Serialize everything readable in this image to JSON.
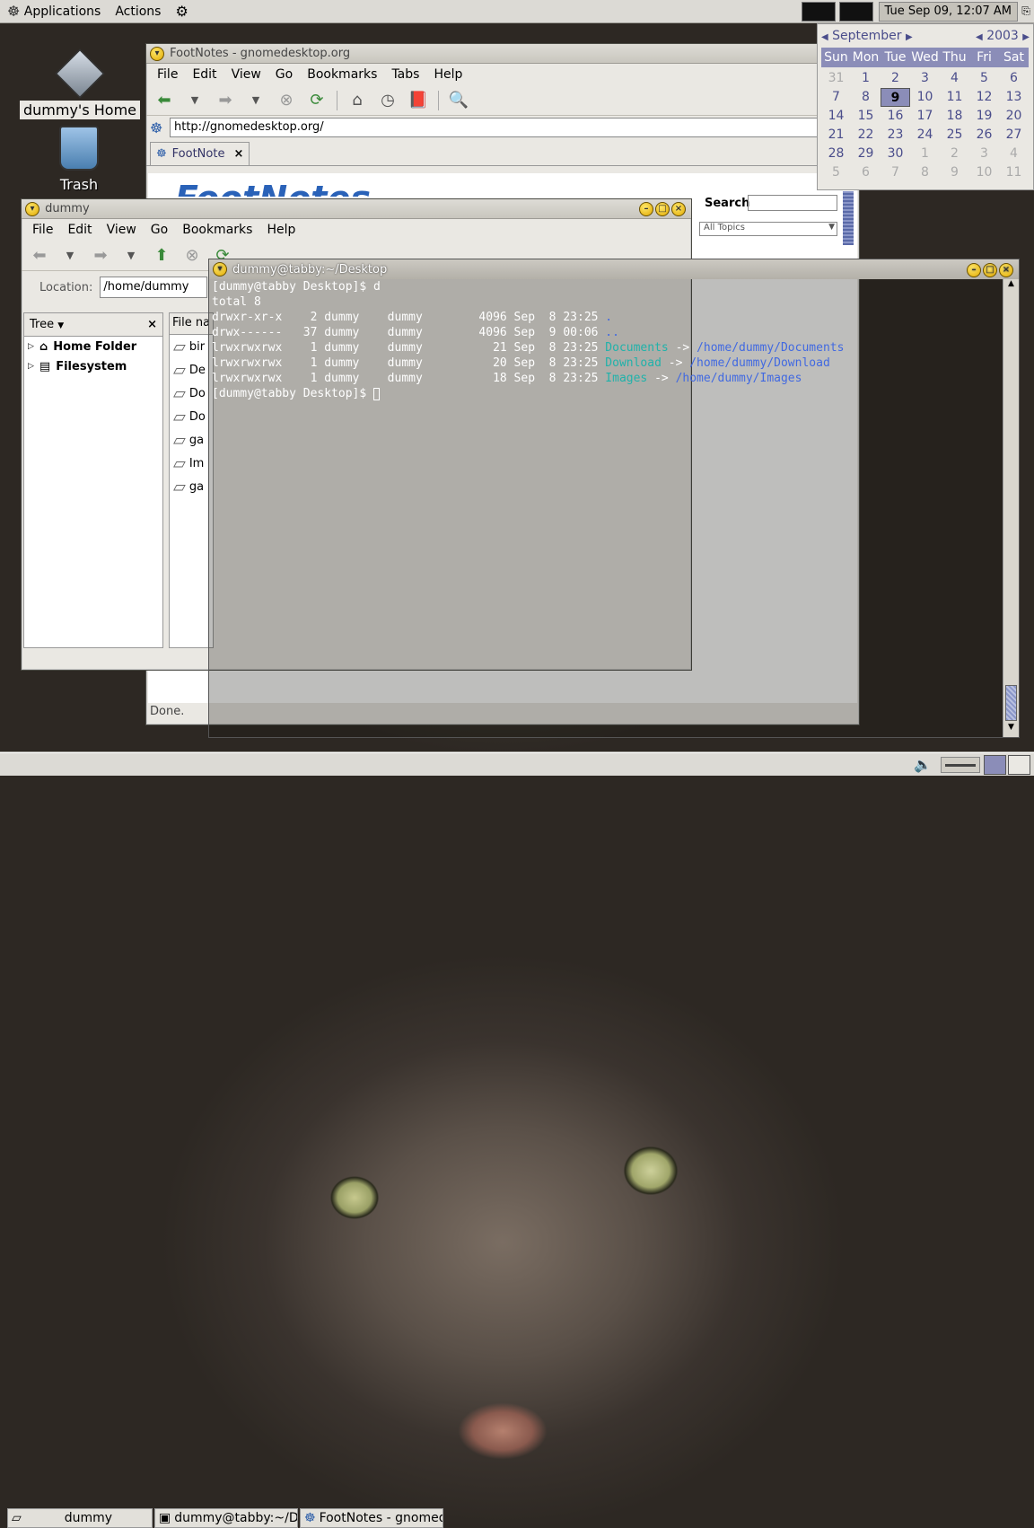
{
  "top_panel": {
    "applications": "Applications",
    "actions": "Actions",
    "clock": "Tue Sep 09, 12:07 AM"
  },
  "calendar": {
    "month": "September",
    "year": "2003",
    "weekdays": [
      "Sun",
      "Mon",
      "Tue",
      "Wed",
      "Thu",
      "Fri",
      "Sat"
    ],
    "days": [
      [
        "31",
        "1",
        "2",
        "3",
        "4",
        "5",
        "6"
      ],
      [
        "7",
        "8",
        "9",
        "10",
        "11",
        "12",
        "13"
      ],
      [
        "14",
        "15",
        "16",
        "17",
        "18",
        "19",
        "20"
      ],
      [
        "21",
        "22",
        "23",
        "24",
        "25",
        "26",
        "27"
      ],
      [
        "28",
        "29",
        "30",
        "1",
        "2",
        "3",
        "4"
      ],
      [
        "5",
        "6",
        "7",
        "8",
        "9",
        "10",
        "11"
      ]
    ],
    "today": "9"
  },
  "desktop": {
    "home": "dummy's Home",
    "trash": "Trash"
  },
  "browser": {
    "title": "FootNotes - gnomedesktop.org",
    "menu": [
      "File",
      "Edit",
      "View",
      "Go",
      "Bookmarks",
      "Tabs",
      "Help"
    ],
    "url": "http://gnomedesktop.org/",
    "tab": "FootNote",
    "search_label": "Search",
    "topics": "All Topics",
    "status": "Done.",
    "brand": "FootNotes"
  },
  "files": {
    "title": "dummy",
    "menu": [
      "File",
      "Edit",
      "View",
      "Go",
      "Bookmarks",
      "Help"
    ],
    "location_label": "Location:",
    "location": "/home/dummy",
    "tree_label": "Tree",
    "tree": [
      "Home Folder",
      "Filesystem"
    ],
    "file_col": "File na",
    "files": [
      "bir",
      "De",
      "Do",
      "Do",
      "ga",
      "Im",
      "ga"
    ]
  },
  "terminal": {
    "title": "dummy@tabby:~/Desktop",
    "lines": [
      {
        "t": "[dummy@tabby Desktop]$ d"
      },
      {
        "t": "total 8"
      },
      {
        "t": "drwxr-xr-x    2 dummy    dummy        4096 Sep  8 23:25 ",
        "c": ".",
        "cc": "#4169e1"
      },
      {
        "t": "drwx------   37 dummy    dummy        4096 Sep  9 00:06 ",
        "c": "..",
        "cc": "#4169e1"
      },
      {
        "t": "lrwxrwxrwx    1 dummy    dummy          21 Sep  8 23:25 ",
        "c": "Documents",
        "cc": "#20b2aa",
        "a": " -> ",
        "d": "/home/dummy/Documents"
      },
      {
        "t": "lrwxrwxrwx    1 dummy    dummy          20 Sep  8 23:25 ",
        "c": "Download",
        "cc": "#20b2aa",
        "a": " -> ",
        "d": "/home/dummy/Download"
      },
      {
        "t": "lrwxrwxrwx    1 dummy    dummy          18 Sep  8 23:25 ",
        "c": "Images",
        "cc": "#20b2aa",
        "a": " -> ",
        "d": "/home/dummy/Images"
      },
      {
        "t": "[dummy@tabby Desktop]$ ",
        "cursor": true
      }
    ]
  },
  "taskbar": [
    "dummy",
    "dummy@tabby:~/Des",
    "FootNotes - gnomedes"
  ]
}
